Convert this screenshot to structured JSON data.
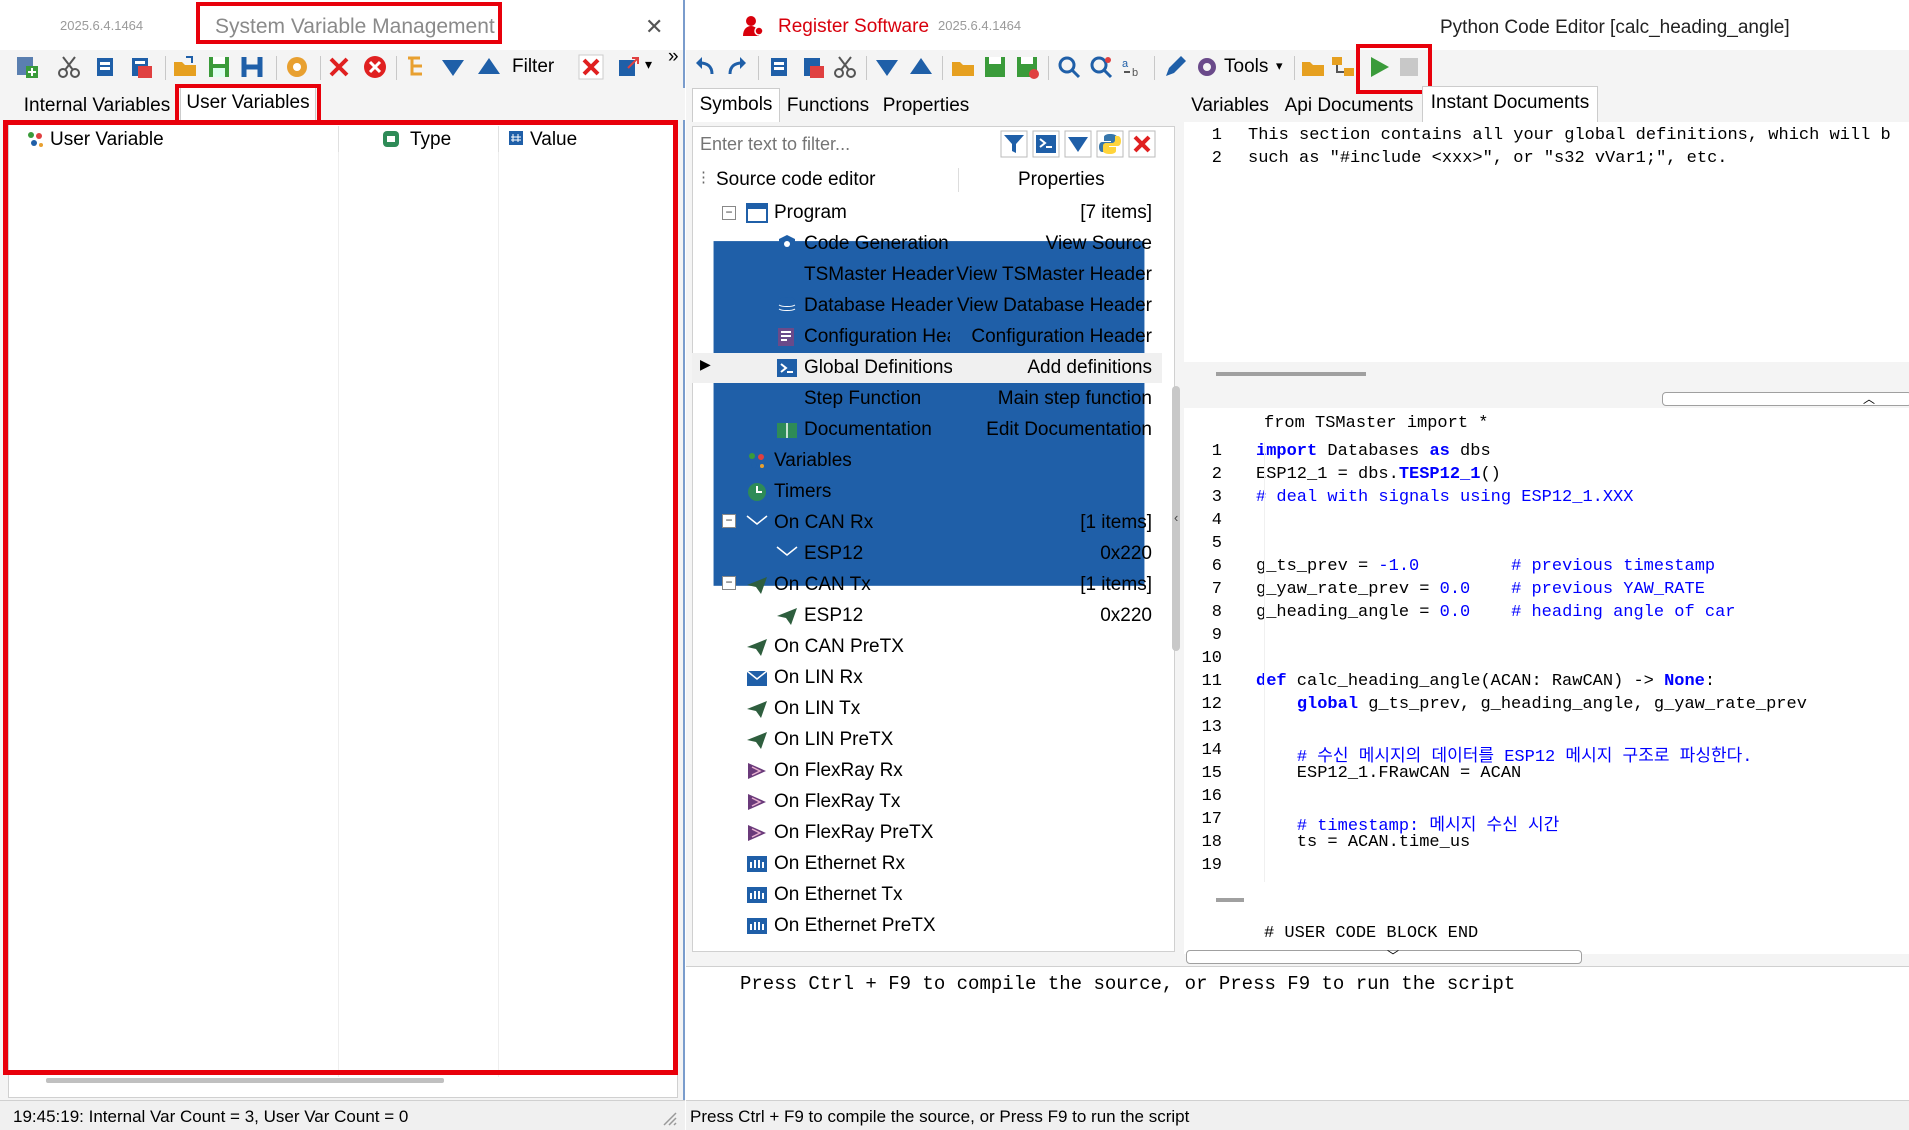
{
  "left": {
    "version": "2025.6.4.1464",
    "title": "System Variable Management",
    "close_glyph": "✕",
    "filter_label": "Filter",
    "overflow_glyph": "»",
    "tabs": [
      "Internal Variables",
      "User Variables"
    ],
    "columns": [
      "User Variable",
      "Type",
      "Value"
    ],
    "status": "19:45:19: Internal Var Count = 3, User Var Count = 0"
  },
  "right": {
    "register_label": "Register Software",
    "version": "2025.6.4.1464",
    "title": "Python Code Editor [calc_heading_angle]",
    "tools_label": "Tools",
    "symbol_tabs": [
      "Symbols",
      "Functions",
      "Properties"
    ],
    "doc_tabs": [
      "Variables",
      "Api Documents",
      "Instant Documents"
    ],
    "filter_placeholder": "Enter text to filter...",
    "tree_header": [
      "Source code editor",
      "Properties"
    ],
    "tree": [
      {
        "label": "Program",
        "right": "[7 items]",
        "icon": "program-icon"
      },
      {
        "label": "Code Generation",
        "right": "View Source",
        "icon": "gear-icon"
      },
      {
        "label": "TSMaster Header",
        "right": "View TSMaster Header",
        "icon": "h-icon"
      },
      {
        "label": "Database Header",
        "right": "View Database Header",
        "icon": "database-icon"
      },
      {
        "label": "Configuration Header",
        "right": "Configuration Header",
        "icon": "config-icon"
      },
      {
        "label": "Global Definitions",
        "right": "Add definitions",
        "icon": "powershell-icon"
      },
      {
        "label": "Step Function",
        "right": "Main step function",
        "icon": "triangle-down-icon"
      },
      {
        "label": "Documentation",
        "right": "Edit Documentation",
        "icon": "book-icon"
      },
      {
        "label": "Variables",
        "right": "",
        "icon": "variables-icon"
      },
      {
        "label": "Timers",
        "right": "",
        "icon": "clock-icon"
      },
      {
        "label": "On CAN Rx",
        "right": "[1 items]",
        "icon": "mail-icon"
      },
      {
        "label": "ESP12",
        "right": "0x220",
        "icon": "mail-icon"
      },
      {
        "label": "On CAN Tx",
        "right": "[1 items]",
        "icon": "send-icon"
      },
      {
        "label": "ESP12",
        "right": "0x220",
        "icon": "send-icon"
      },
      {
        "label": "On CAN PreTX",
        "right": "",
        "icon": "send-icon"
      },
      {
        "label": "On LIN Rx",
        "right": "",
        "icon": "mail-icon"
      },
      {
        "label": "On LIN Tx",
        "right": "",
        "icon": "send-icon"
      },
      {
        "label": "On LIN PreTX",
        "right": "",
        "icon": "send-icon"
      },
      {
        "label": "On FlexRay Rx",
        "right": "",
        "icon": "flexray-icon"
      },
      {
        "label": "On FlexRay Tx",
        "right": "",
        "icon": "flexray-icon"
      },
      {
        "label": "On FlexRay PreTX",
        "right": "",
        "icon": "flexray-icon"
      },
      {
        "label": "On Ethernet Rx",
        "right": "",
        "icon": "ethernet-icon"
      },
      {
        "label": "On Ethernet Tx",
        "right": "",
        "icon": "ethernet-icon"
      },
      {
        "label": "On Ethernet PreTX",
        "right": "",
        "icon": "ethernet-icon"
      }
    ],
    "instant_doc": {
      "line1": "This section contains all your global definitions, which will b",
      "line2": "such as \"#include <xxx>\", or \"s32 vVar1;\", etc."
    },
    "code_header": "from TSMaster import *",
    "code_footer": "# USER CODE BLOCK END",
    "code": [
      "import Databases as dbs",
      "ESP12_1 = dbs.TESP12_1()",
      "# deal with signals using ESP12_1.XXX",
      "",
      "",
      "g_ts_prev = -1.0         # previous timestamp",
      "g_yaw_rate_prev = 0.0    # previous YAW_RATE",
      "g_heading_angle = 0.0    # heading angle of car",
      "",
      "",
      "def calc_heading_angle(ACAN: RawCAN) -> None:",
      "    global g_ts_prev, g_heading_angle, g_yaw_rate_prev",
      "",
      "    # 수신 메시지의 데이터를 ESP12 메시지 구조로 파싱한다.",
      "    ESP12_1.FRawCAN = ACAN",
      "",
      "    # timestamp: 메시지 수신 시간",
      "    ts = ACAN.time_us",
      ""
    ],
    "output": "Press Ctrl + F9 to compile the source, or Press F9 to run the script",
    "status": "Press Ctrl + F9 to compile the source, or Press F9 to run the script"
  },
  "colors": {
    "highlight": "#e8000b",
    "accent": "#1f5fa8",
    "register": "#d8000c"
  }
}
